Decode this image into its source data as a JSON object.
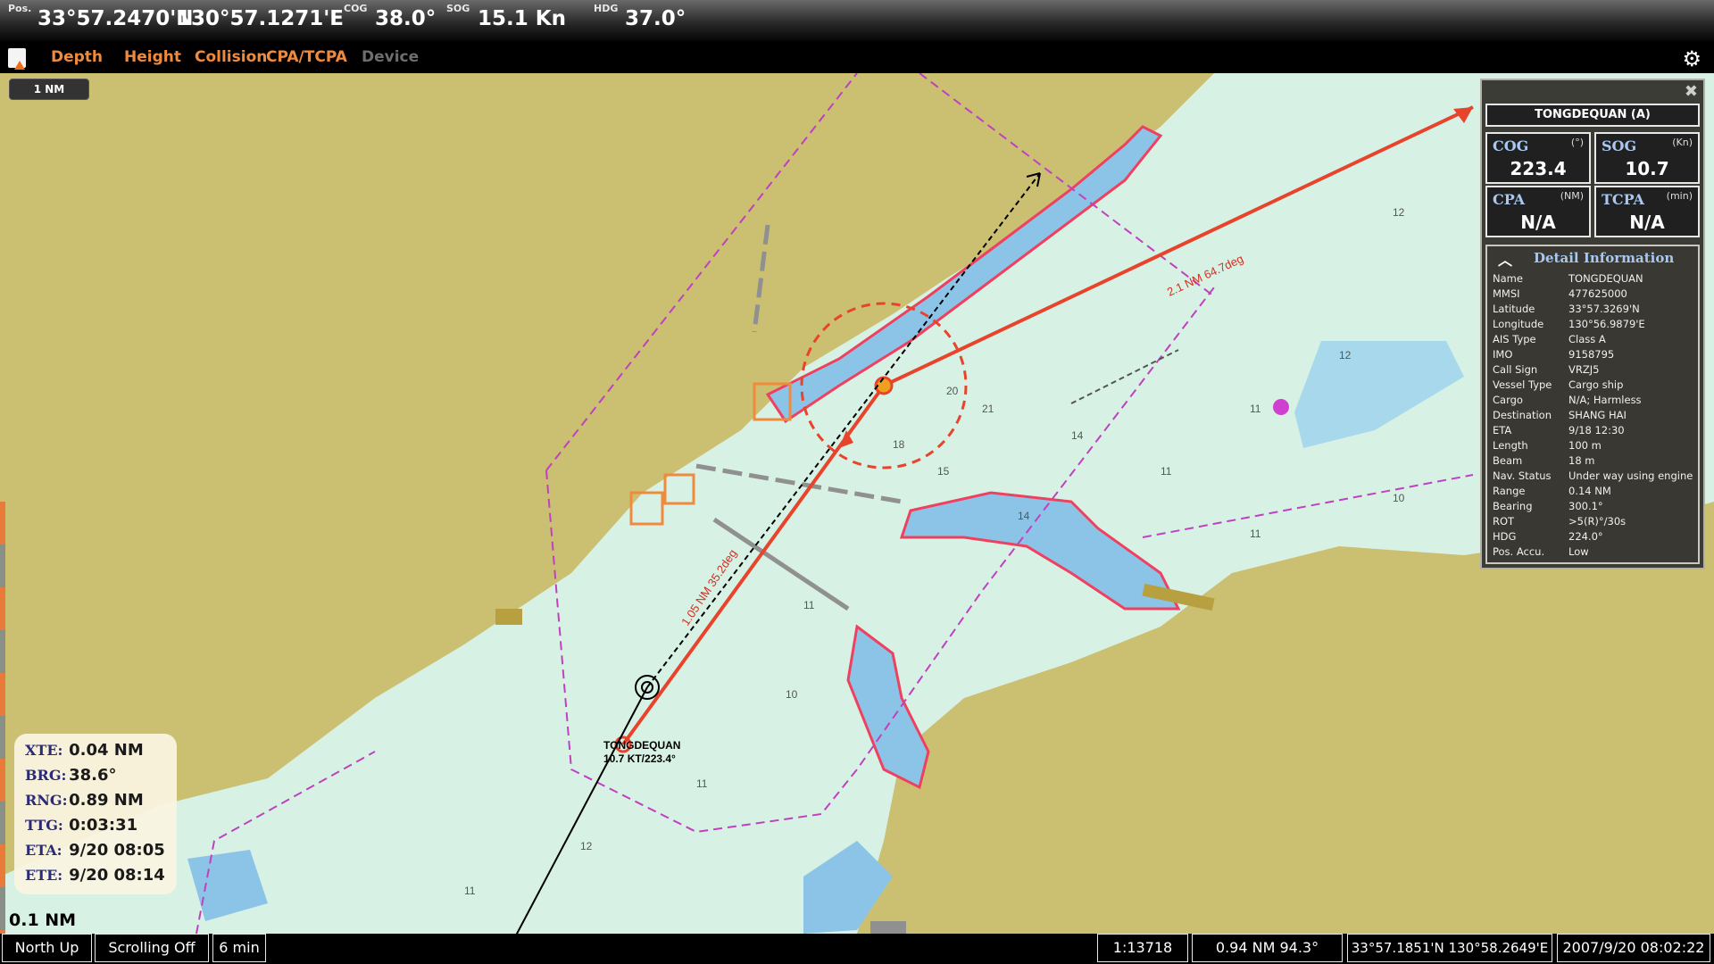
{
  "topbar": {
    "pos_label": "Pos.",
    "lat": "33°57.2470'N",
    "lon": "130°57.1271'E",
    "cog_label": "COG",
    "cog": "38.0°",
    "sog_label": "SOG",
    "sog": "15.1 Kn",
    "hdg_label": "HDG",
    "hdg": "37.0°"
  },
  "menu": {
    "items": [
      {
        "label": "Depth",
        "enabled": true
      },
      {
        "label": "Height",
        "enabled": true
      },
      {
        "label": "Collision",
        "enabled": true
      },
      {
        "label": "CPA/TCPA",
        "enabled": true
      },
      {
        "label": "Device",
        "enabled": false
      }
    ],
    "app_icon": "alarm-app-icon",
    "settings_icon": "gear-icon"
  },
  "chart": {
    "scale_top": "1 NM",
    "scale_bottom": "0.1 NM",
    "target_label_name": "TONGDEQUAN",
    "target_label_motion": "10.7 KT/223.4°",
    "route_leg_1": "2.1 NM 64.7deg",
    "route_leg_2": "1.05 NM 35.2deg",
    "colors": {
      "land": "#cbbf72",
      "shallow": "#8cc4e8",
      "deep": "#d7f2e4",
      "route": "#e8442c",
      "boundary": "#c040c0",
      "danger": "#f04060"
    }
  },
  "route_info": [
    {
      "label": "XTE:",
      "value": "0.04 NM"
    },
    {
      "label": "BRG:",
      "value": "38.6°"
    },
    {
      "label": "RNG:",
      "value": "0.89 NM"
    },
    {
      "label": "TTG:",
      "value": "0:03:31"
    },
    {
      "label": "ETA:",
      "value": "9/20 08:05"
    },
    {
      "label": "ETE:",
      "value": "9/20 08:14"
    }
  ],
  "target_panel": {
    "title": "TONGDEQUAN (A)",
    "close_icon": "close-icon",
    "cog": {
      "label": "COG",
      "unit": "(°)",
      "value": "223.4"
    },
    "sog": {
      "label": "SOG",
      "unit": "(Kn)",
      "value": "10.7"
    },
    "cpa": {
      "label": "CPA",
      "unit": "(NM)",
      "value": "N/A"
    },
    "tcpa": {
      "label": "TCPA",
      "unit": "(min)",
      "value": "N/A"
    },
    "detail_header": "Detail Information",
    "details": [
      {
        "key": "Name",
        "value": "TONGDEQUAN"
      },
      {
        "key": "MMSI",
        "value": "477625000"
      },
      {
        "key": "Latitude",
        "value": "33°57.3269'N"
      },
      {
        "key": "Longitude",
        "value": "130°56.9879'E"
      },
      {
        "key": "AIS Type",
        "value": "Class A"
      },
      {
        "key": "IMO",
        "value": "9158795"
      },
      {
        "key": "Call Sign",
        "value": "VRZJ5"
      },
      {
        "key": "Vessel Type",
        "value": "Cargo ship"
      },
      {
        "key": "Cargo",
        "value": "N/A; Harmless"
      },
      {
        "key": "Destination",
        "value": "SHANG HAI"
      },
      {
        "key": "ETA",
        "value": "9/18 12:30"
      },
      {
        "key": "Length",
        "value": "100 m"
      },
      {
        "key": "Beam",
        "value": "18 m"
      },
      {
        "key": "Nav. Status",
        "value": "Under way using engine"
      },
      {
        "key": "Range",
        "value": "0.14 NM"
      },
      {
        "key": "Bearing",
        "value": "300.1°"
      },
      {
        "key": "ROT",
        "value": ">5(R)°/30s"
      },
      {
        "key": "HDG",
        "value": "224.0°"
      },
      {
        "key": "Pos. Accu.",
        "value": "Low"
      }
    ]
  },
  "bottombar": {
    "orientation": "North Up",
    "scrolling": "Scrolling Off",
    "vector_time": "6 min",
    "scale": "1:13718",
    "cursor_range_bearing": "0.94 NM 94.3°",
    "cursor_position": "33°57.1851'N  130°58.2649'E",
    "datetime": "2007/9/20 08:02:22"
  }
}
